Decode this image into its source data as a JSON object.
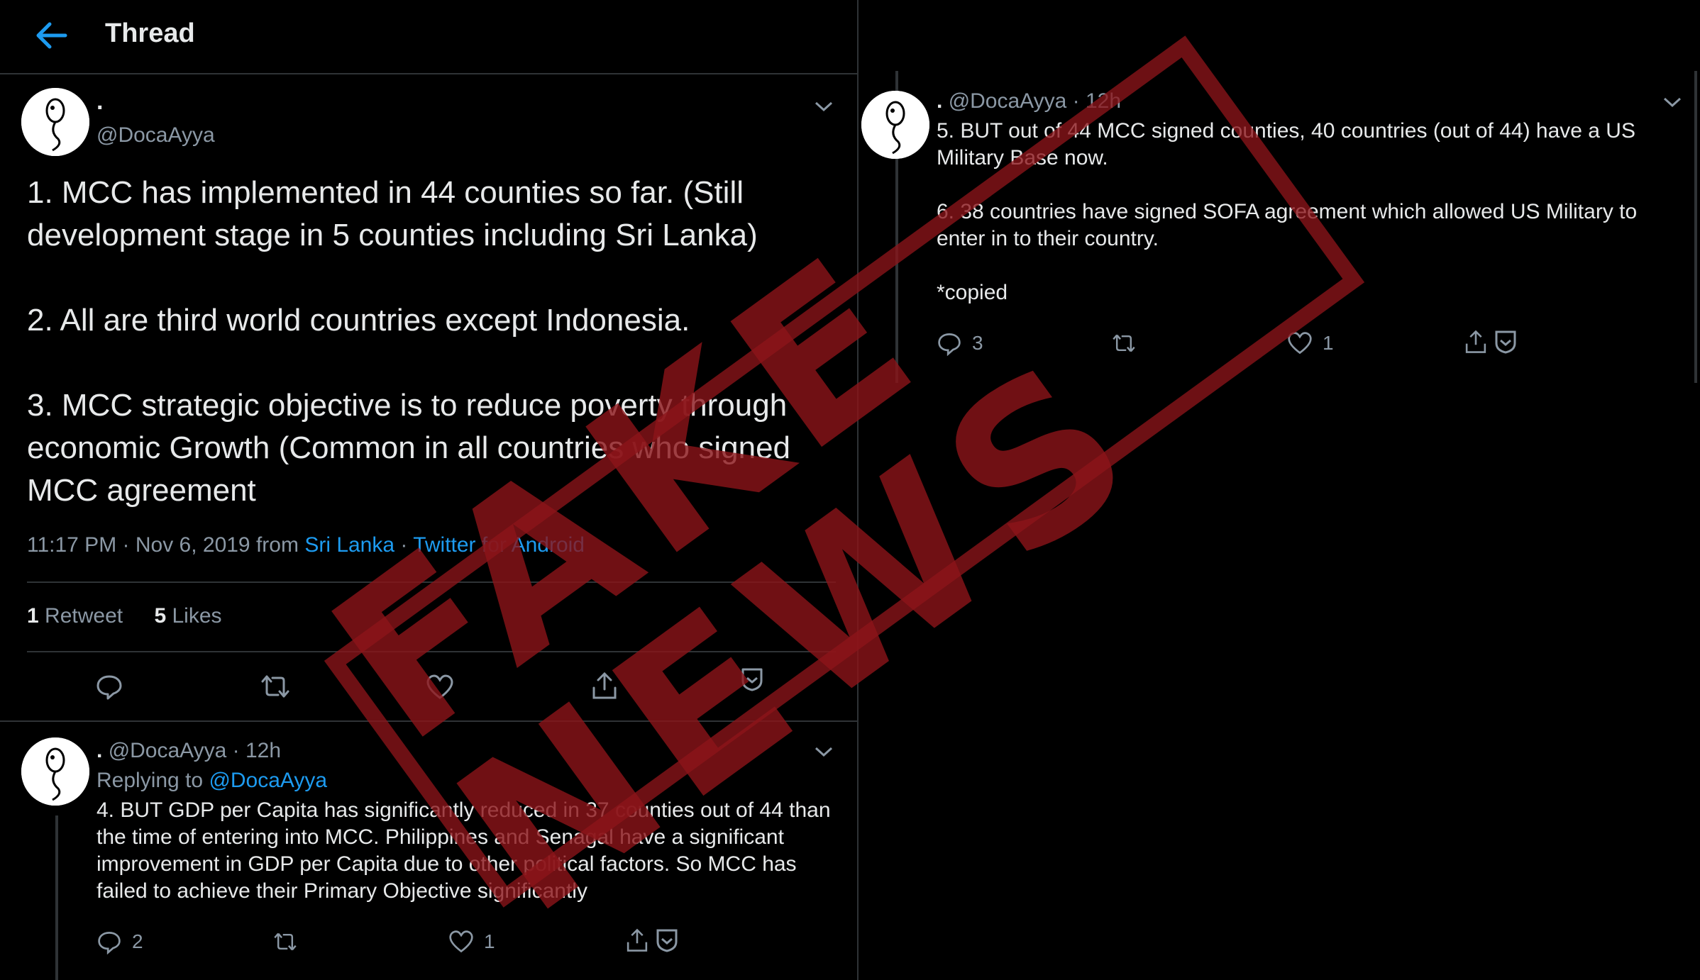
{
  "header": {
    "title": "Thread"
  },
  "main_tweet": {
    "display_name": ".",
    "handle": "@DocaAyya",
    "text": "1. MCC has implemented in 44 counties so far. (Still development stage in 5 counties including Sri Lanka)\n\n2. All are third world countries except Indonesia.\n\n3. MCC strategic objective is to reduce poverty through economic Growth (Common in all countries who signed MCC agreement",
    "time": "11:17 PM · Nov 6, 2019 from",
    "location": "Sri Lanka",
    "separator": "·",
    "source": "Twitter for Android",
    "retweets_count": "1",
    "retweets_label": "Retweet",
    "likes_count": "5",
    "likes_label": "Likes"
  },
  "reply_tweet": {
    "display_name": ".",
    "handle": "@DocaAyya",
    "time": "· 12h",
    "replying_label": "Replying to",
    "replying_handle": "@DocaAyya",
    "text": "4. BUT GDP per Capita has significantly reduced in 37 counties out of 44 than the time of entering into MCC. Philippines and Senagal have a significant improvement in GDP per Capita due to other political factors. So MCC has failed to achieve their Primary Objective significantly",
    "replies": "2",
    "likes": "1"
  },
  "right_tweet": {
    "display_name": ".",
    "handle": "@DocaAyya",
    "time": "· 12h",
    "text": "5. BUT out of 44 MCC signed counties, 40 countries (out of 44) have a US Military Base now.\n\n6. 38 countries have signed SOFA agreement which allowed US Military to enter in to their country.\n\n*copied",
    "replies": "3",
    "likes": "1"
  },
  "stamp": {
    "text": "FAKE NEWS",
    "color": "#8c1419"
  },
  "colors": {
    "background": "#000000",
    "link": "#1d9bf0",
    "muted": "#8b98a5",
    "border": "#2f3336"
  },
  "icons": [
    "back-arrow-icon",
    "chevron-down-icon",
    "reply-icon",
    "retweet-icon",
    "like-icon",
    "share-icon",
    "bookmark-icon"
  ]
}
